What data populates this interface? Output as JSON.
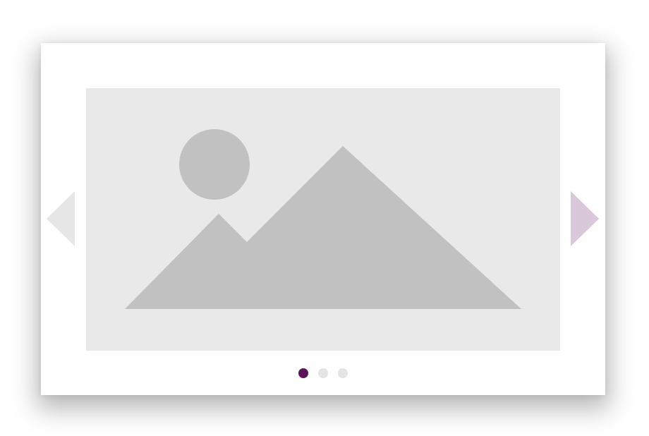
{
  "carousel": {
    "colors": {
      "image_background": "#e9e9e9",
      "image_shapes": "#c1c1c1",
      "prev_arrow": "#e6e6e6",
      "next_arrow": "#d9c8d9",
      "dot_active": "#5b1459",
      "dot_inactive": "#e4e4e4"
    },
    "slide": {
      "icon": "image-placeholder-icon"
    },
    "prev": {
      "icon": "chevron-left-triangle-icon"
    },
    "next": {
      "icon": "chevron-right-triangle-icon"
    },
    "pagination": {
      "total": 3,
      "active_index": 0
    }
  }
}
